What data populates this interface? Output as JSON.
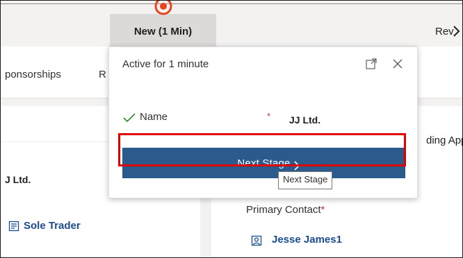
{
  "stage_bar": {
    "active_stage_label": "New  (1 Min)",
    "next_stage_label_partial": "Rev",
    "accent_color": "#e8431f"
  },
  "tabs": {
    "items": [
      {
        "label": "ponsorships"
      },
      {
        "label": "R"
      }
    ]
  },
  "left_card": {
    "account_name": "J Ltd.",
    "type_value": "Sole Trader"
  },
  "right_card": {
    "pending_text": "ding App",
    "primary_contact_label": "Primary Contact",
    "required_marker": "*",
    "primary_contact_value": "Jesse James1"
  },
  "flyout": {
    "title": "Active for 1 minute",
    "field_label": "Name",
    "required_marker": "*",
    "field_value": "JJ Ltd.",
    "next_button_label": "Next Stage",
    "tooltip": "Next Stage",
    "button_color": "#2b5a8c",
    "highlight_color": "#e10000"
  }
}
